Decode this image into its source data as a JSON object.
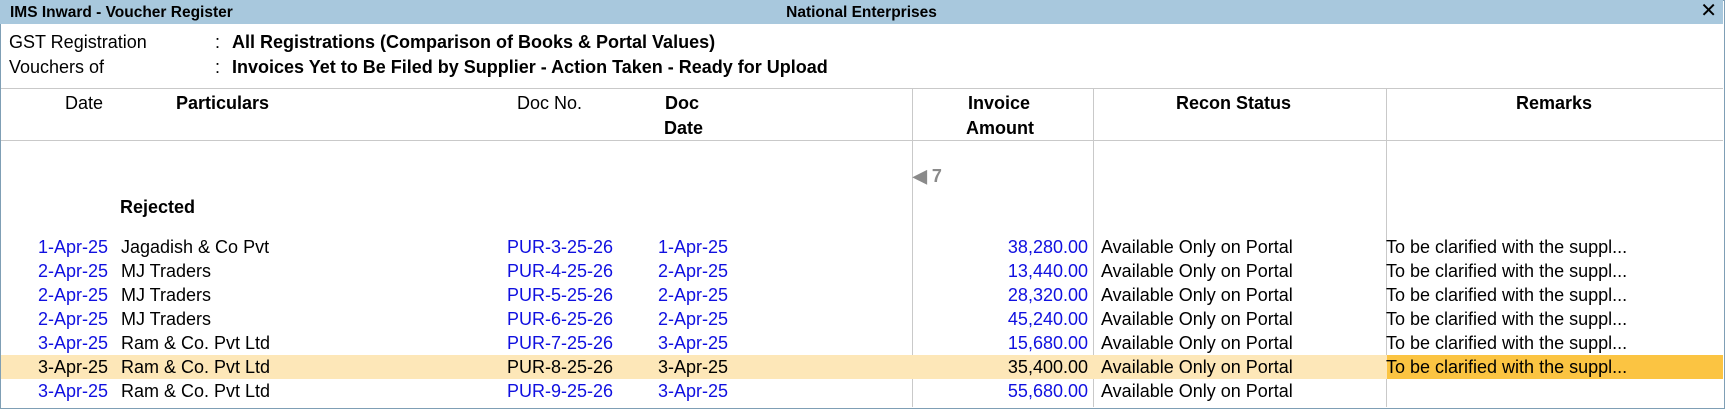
{
  "window": {
    "title": "IMS Inward - Voucher Register",
    "company": "National Enterprises",
    "close_glyph": "✕"
  },
  "info": {
    "gst_label": "GST Registration",
    "gst_value": "All Registrations (Comparison of Books & Portal Values)",
    "vouchers_label": "Vouchers of",
    "vouchers_value": "Invoices Yet to Be Filed by Supplier - Action Taken - Ready for Upload",
    "separator": ":"
  },
  "columns": {
    "date": "Date",
    "particulars": "Particulars",
    "doc_no": "Doc No.",
    "doc_date_line1": "Doc",
    "doc_date_line2": "Date",
    "amount_line1": "Invoice",
    "amount_line2": "Amount",
    "recon_status": "Recon Status",
    "remarks": "Remarks"
  },
  "indicator": {
    "glyph": "◀",
    "value": "7"
  },
  "section": "Rejected",
  "rows": [
    {
      "date": "1-Apr-25",
      "particulars": "Jagadish & Co Pvt",
      "doc_no": "PUR-3-25-26",
      "doc_date": "1-Apr-25",
      "amount": "38,280.00",
      "recon": "Available Only on Portal",
      "remarks": "To be clarified with the suppl..."
    },
    {
      "date": "2-Apr-25",
      "particulars": "MJ Traders",
      "doc_no": "PUR-4-25-26",
      "doc_date": "2-Apr-25",
      "amount": "13,440.00",
      "recon": "Available Only on Portal",
      "remarks": "To be clarified with the suppl..."
    },
    {
      "date": "2-Apr-25",
      "particulars": "MJ Traders",
      "doc_no": "PUR-5-25-26",
      "doc_date": "2-Apr-25",
      "amount": "28,320.00",
      "recon": "Available Only on Portal",
      "remarks": "To be clarified with the suppl..."
    },
    {
      "date": "2-Apr-25",
      "particulars": "MJ Traders",
      "doc_no": "PUR-6-25-26",
      "doc_date": "2-Apr-25",
      "amount": "45,240.00",
      "recon": "Available Only on Portal",
      "remarks": "To be clarified with the suppl..."
    },
    {
      "date": "3-Apr-25",
      "particulars": "Ram & Co. Pvt Ltd",
      "doc_no": "PUR-7-25-26",
      "doc_date": "3-Apr-25",
      "amount": "15,680.00",
      "recon": "Available Only on Portal",
      "remarks": "To be clarified with the suppl..."
    },
    {
      "date": "3-Apr-25",
      "particulars": "Ram & Co. Pvt Ltd",
      "doc_no": "PUR-8-25-26",
      "doc_date": "3-Apr-25",
      "amount": "35,400.00",
      "recon": "Available Only on Portal",
      "remarks": "To be clarified with the suppl...",
      "selected": true
    },
    {
      "date": "3-Apr-25",
      "particulars": "Ram & Co. Pvt Ltd",
      "doc_no": "PUR-9-25-26",
      "doc_date": "3-Apr-25",
      "amount": "55,680.00",
      "recon": "Available Only on Portal",
      "remarks": ""
    }
  ],
  "colors": {
    "titlebar": "#a8c8dd",
    "link_blue": "#1010e0",
    "selected_row": "#fde7b8",
    "selected_cell": "#fbc442"
  }
}
